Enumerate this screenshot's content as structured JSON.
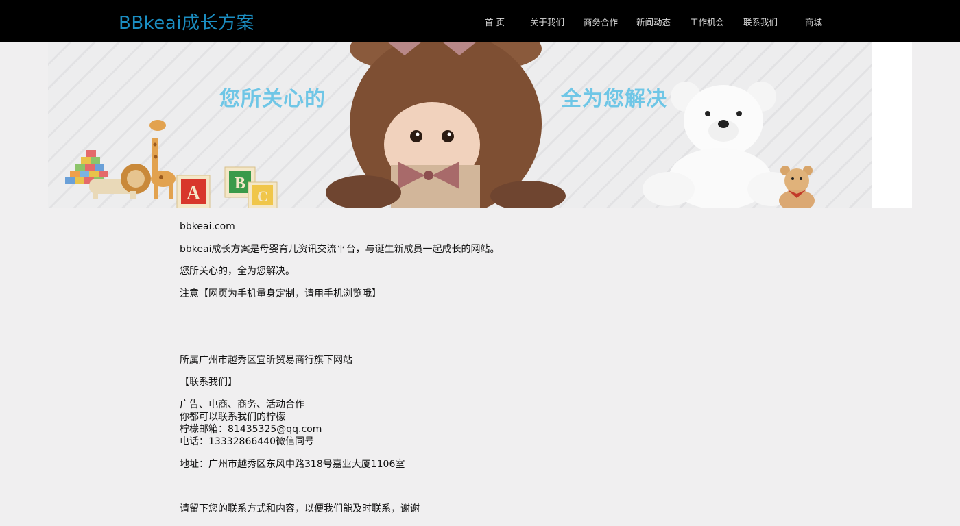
{
  "header": {
    "brand": "BBkeai成长方案",
    "nav": [
      "首 页",
      "关于我们",
      "商务合作",
      "新闻动态",
      "工作机会",
      "联系我们",
      "商城"
    ]
  },
  "banner": {
    "slogan_left": "您所关心的",
    "slogan_right": "全为您解决",
    "block_letters": [
      "A",
      "B",
      "C"
    ]
  },
  "content": {
    "domain": "bbkeai.com",
    "intro": "bbkeai成长方案是母婴育儿资讯交流平台，与诞生新成员一起成长的网站。",
    "tagline": "您所关心的，全为您解决。",
    "notice": "注意【网页为手机量身定制，请用手机浏览哦】",
    "owner": "所属广州市越秀区宜昕贸易商行旗下网站",
    "contact_heading": "【联系我们】",
    "contact_lines": [
      "广告、电商、商务、活动合作",
      "你都可以联系我们的柠檬",
      "柠檬邮箱：81435325@qq.com",
      "电话：13332866440微信同号"
    ],
    "address": "地址：广州市越秀区东风中路318号嘉业大厦1106室",
    "footer_note": "请留下您的联系方式和内容，以便我们能及时联系，谢谢"
  },
  "colors": {
    "brand": "#1b8ec2",
    "slogan": "#6fc6e6",
    "topbar": "#000000",
    "page_bg": "#f0eff0"
  }
}
